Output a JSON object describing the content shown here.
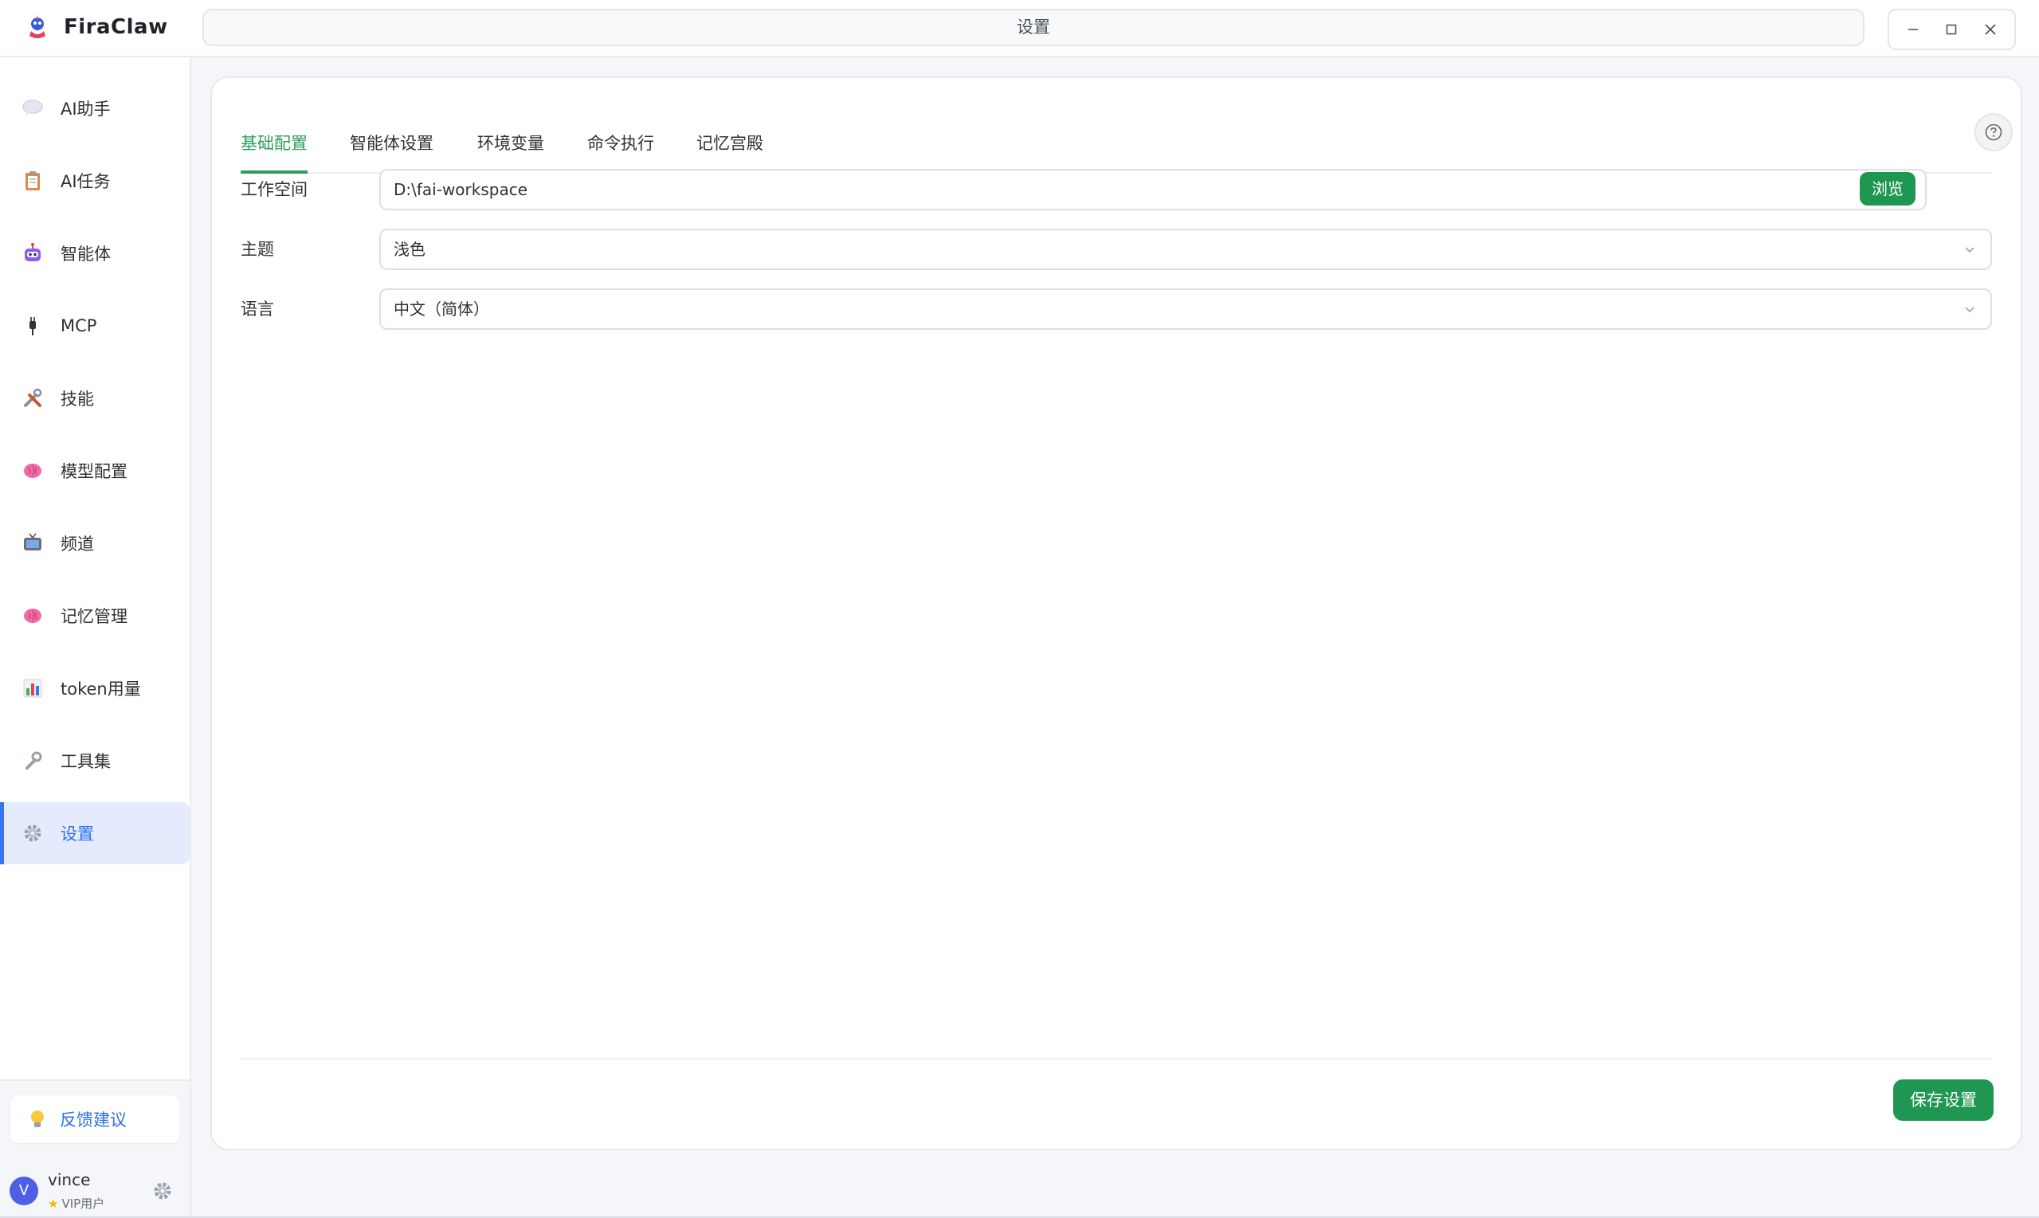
{
  "app": {
    "name": "FiraClaw",
    "window_title": "设置"
  },
  "sidebar": {
    "items": [
      {
        "label": "AI助手",
        "icon": "speech-bubble-icon"
      },
      {
        "label": "AI任务",
        "icon": "clipboard-icon"
      },
      {
        "label": "智能体",
        "icon": "robot-icon"
      },
      {
        "label": "MCP",
        "icon": "plug-icon"
      },
      {
        "label": "技能",
        "icon": "tools-icon"
      },
      {
        "label": "模型配置",
        "icon": "brain-icon"
      },
      {
        "label": "频道",
        "icon": "tv-icon"
      },
      {
        "label": "记忆管理",
        "icon": "brain-icon"
      },
      {
        "label": "token用量",
        "icon": "bar-chart-icon"
      },
      {
        "label": "工具集",
        "icon": "wrench-icon"
      },
      {
        "label": "设置",
        "icon": "gear-icon",
        "active": true
      }
    ],
    "feedback_label": "反馈建议",
    "user": {
      "initial": "V",
      "name": "vince",
      "badge": "VIP用户"
    }
  },
  "tabs": [
    {
      "label": "基础配置",
      "active": true
    },
    {
      "label": "智能体设置"
    },
    {
      "label": "环境变量"
    },
    {
      "label": "命令执行"
    },
    {
      "label": "记忆宫殿"
    }
  ],
  "form": {
    "workspace": {
      "label": "工作空间",
      "value": "D:\\fai-workspace",
      "browse_label": "浏览"
    },
    "theme": {
      "label": "主题",
      "value": "浅色"
    },
    "language": {
      "label": "语言",
      "value": "中文（简体）"
    }
  },
  "save_label": "保存设置",
  "colors": {
    "accent_green": "#1f9651",
    "active_blue": "#2f6fed",
    "active_bg": "#e3ebfd"
  }
}
